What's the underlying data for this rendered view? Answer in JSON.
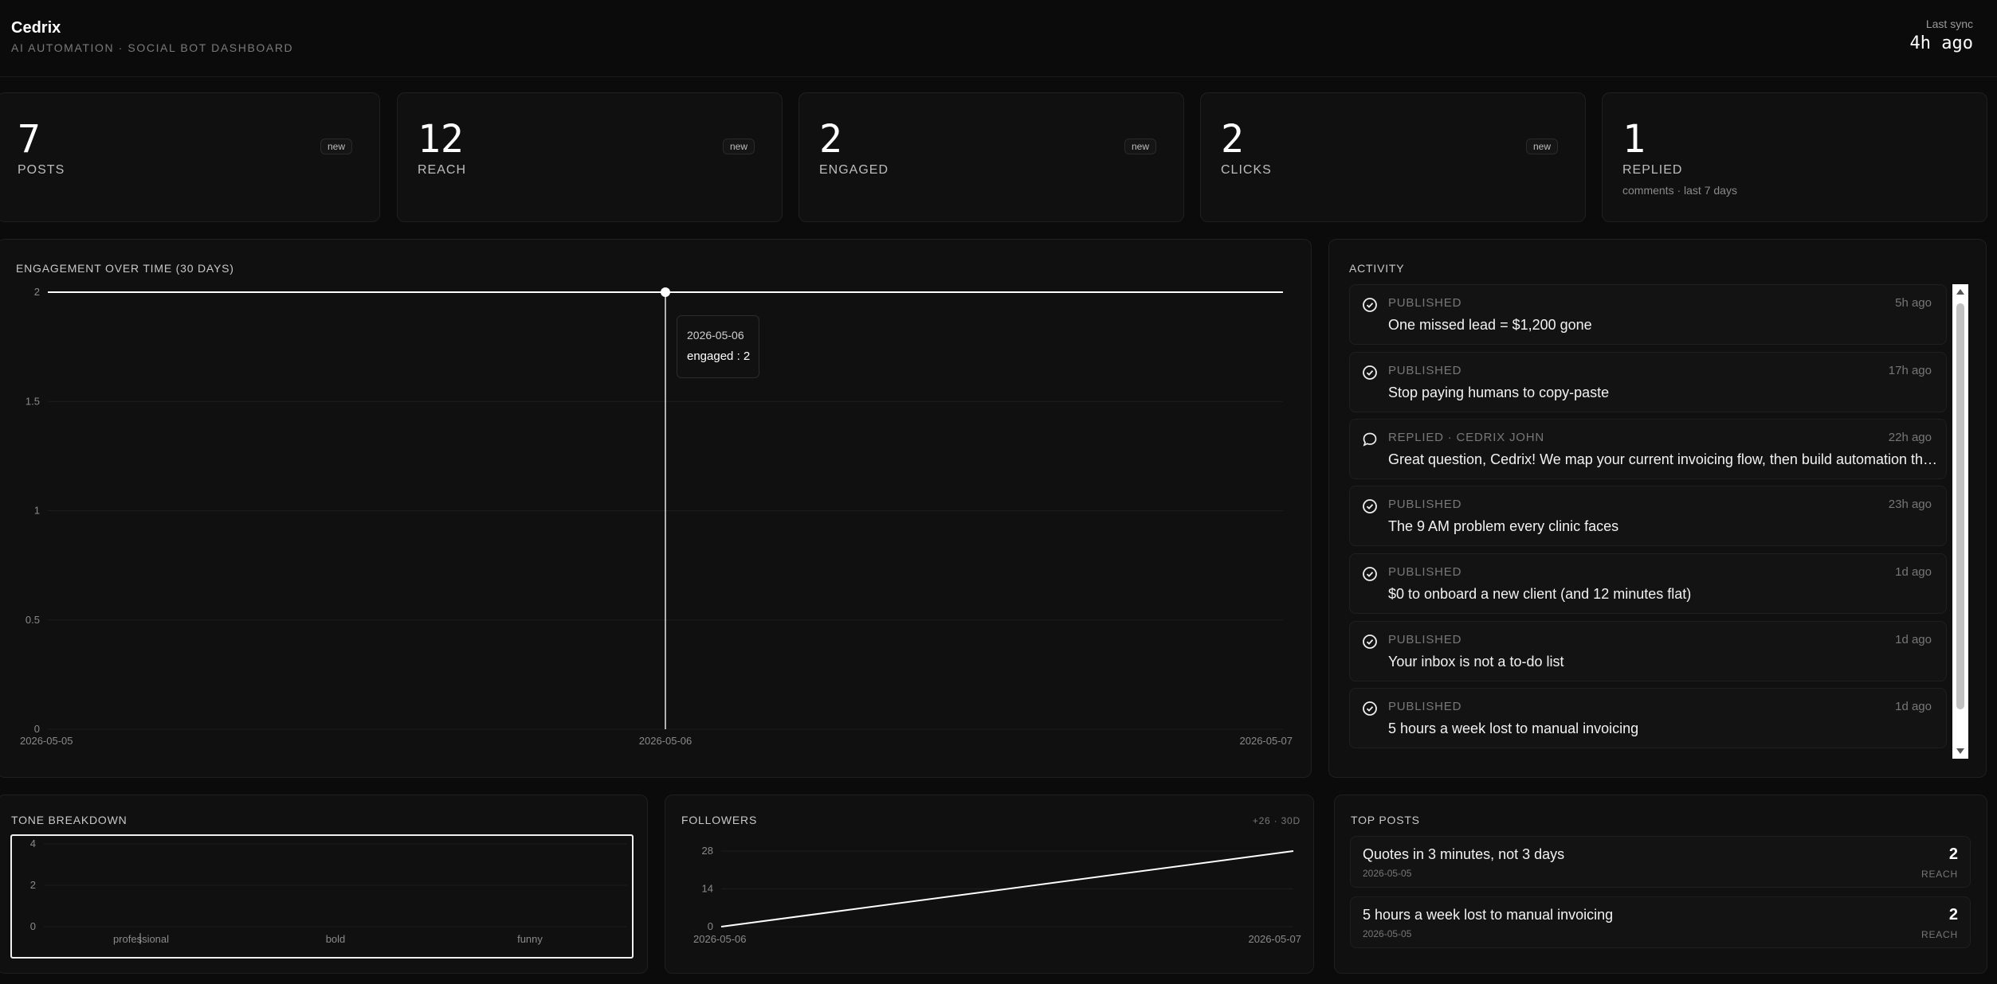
{
  "header": {
    "title": "Cedrix",
    "subtitle": "AI AUTOMATION · SOCIAL BOT DASHBOARD",
    "sync_label": "Last sync",
    "sync_value": "4h ago"
  },
  "stats": [
    {
      "value": "7",
      "label": "POSTS",
      "badge": "new"
    },
    {
      "value": "12",
      "label": "REACH",
      "badge": "new"
    },
    {
      "value": "2",
      "label": "ENGAGED",
      "badge": "new"
    },
    {
      "value": "2",
      "label": "CLICKS",
      "badge": "new"
    },
    {
      "value": "1",
      "label": "REPLIED",
      "note": "comments · last 7 days"
    }
  ],
  "engagement": {
    "title": "ENGAGEMENT OVER TIME (30 DAYS)",
    "tooltip_date": "2026-05-06",
    "tooltip_value": "engaged : 2"
  },
  "activity": {
    "title": "ACTIVITY",
    "items": [
      {
        "icon": "check-circle-icon",
        "type": "PUBLISHED",
        "time": "5h ago",
        "text": "One missed lead = $1,200 gone"
      },
      {
        "icon": "check-circle-icon",
        "type": "PUBLISHED",
        "time": "17h ago",
        "text": "Stop paying humans to copy-paste"
      },
      {
        "icon": "comment-icon",
        "type": "REPLIED · CEDRIX JOHN",
        "time": "22h ago",
        "text": "Great question, Cedrix! We map your current invoicing flow, then build automation that..."
      },
      {
        "icon": "check-circle-icon",
        "type": "PUBLISHED",
        "time": "23h ago",
        "text": "The 9 AM problem every clinic faces"
      },
      {
        "icon": "check-circle-icon",
        "type": "PUBLISHED",
        "time": "1d ago",
        "text": "$0 to onboard a new client (and 12 minutes flat)"
      },
      {
        "icon": "check-circle-icon",
        "type": "PUBLISHED",
        "time": "1d ago",
        "text": "Your inbox is not a to-do list"
      },
      {
        "icon": "check-circle-icon",
        "type": "PUBLISHED",
        "time": "1d ago",
        "text": "5 hours a week lost to manual invoicing"
      }
    ]
  },
  "tone": {
    "title": "TONE BREAKDOWN"
  },
  "followers": {
    "title": "FOLLOWERS",
    "delta": "+26 · 30D"
  },
  "top_posts": {
    "title": "TOP POSTS",
    "items": [
      {
        "title": "Quotes in 3 minutes, not 3 days",
        "date": "2026-05-05",
        "value": "2",
        "unit": "REACH"
      },
      {
        "title": "5 hours a week lost to manual invoicing",
        "date": "2026-05-05",
        "value": "2",
        "unit": "REACH"
      }
    ]
  },
  "chart_data": [
    {
      "type": "line",
      "title": "ENGAGEMENT OVER TIME (30 DAYS)",
      "x": [
        "2026-05-05",
        "2026-05-06",
        "2026-05-07"
      ],
      "series": [
        {
          "values": [
            2,
            2,
            2
          ]
        }
      ],
      "yticks": [
        "0",
        "0.5",
        "1",
        "1.5",
        "2"
      ],
      "ylim": [
        0,
        2
      ],
      "grid": true
    },
    {
      "type": "bar",
      "title": "TONE BREAKDOWN",
      "categories": [
        "professional",
        "bold",
        "funny"
      ],
      "values": [
        0,
        0,
        0
      ],
      "yticks": [
        "0",
        "2",
        "4"
      ],
      "ylim": [
        0,
        4
      ],
      "grid": true
    },
    {
      "type": "line",
      "title": "FOLLOWERS",
      "x": [
        "2026-05-06",
        "2026-05-07"
      ],
      "series": [
        {
          "values": [
            0,
            28
          ]
        }
      ],
      "yticks": [
        "0",
        "14",
        "28"
      ],
      "ylim": [
        0,
        28
      ],
      "grid": true
    }
  ]
}
